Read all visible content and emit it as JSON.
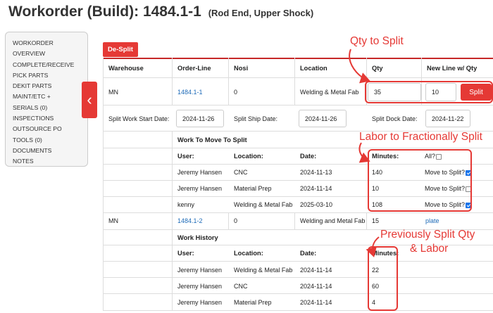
{
  "title": "Workorder (Build): 1484.1-1",
  "subtitle": "(Rod End, Upper Shock)",
  "sidebar": {
    "items": [
      "WORKORDER",
      "OVERVIEW",
      "COMPLETE/RECEIVE",
      "PICK PARTS",
      "DEKIT PARTS",
      "MAINT/ETC +",
      "SERIALS (0)",
      "INSPECTIONS",
      "OUTSOURCE PO",
      "TOOLS (0)",
      "DOCUMENTS",
      "NOTES"
    ]
  },
  "despl_label": "De-Split",
  "table": {
    "headers": [
      "Warehouse",
      "Order-Line",
      "Nosi",
      "Location",
      "Qty",
      "New Line w/ Qty"
    ],
    "row1": {
      "warehouse": "MN",
      "order_line": "1484.1-1",
      "nosi": "0",
      "location": "Welding & Metal Fab",
      "qty": "35",
      "new_qty": "10",
      "split_label": "Split"
    },
    "dates": {
      "work_start_label": "Split Work Start Date:",
      "work_start": "2024-11-26",
      "ship_label": "Split Ship Date:",
      "ship": "2024-11-26",
      "dock_label": "Split Dock Date:",
      "dock": "2024-11-22"
    },
    "work_to_move": {
      "title": "Work To Move To Split",
      "headers": [
        "User:",
        "Location:",
        "Date:",
        "Minutes:",
        "All?"
      ],
      "rows": [
        {
          "user": "Jeremy Hansen",
          "location": "CNC",
          "date": "2024-11-13",
          "minutes": "140",
          "move": "Move to Split?",
          "checked": true
        },
        {
          "user": "Jeremy Hansen",
          "location": "Material Prep",
          "date": "2024-11-14",
          "minutes": "10",
          "move": "Move to Split?",
          "checked": false
        },
        {
          "user": "kenny",
          "location": "Welding & Metal Fab",
          "date": "2025-03-10",
          "minutes": "108",
          "move": "Move to Split?",
          "checked": true
        }
      ]
    },
    "row2": {
      "warehouse": "MN",
      "order_line": "1484.1-2",
      "nosi": "0",
      "location": "Welding and Metal Fab",
      "qty": "15",
      "new": "plate"
    },
    "work_history": {
      "title": "Work History",
      "headers": [
        "User:",
        "Location:",
        "Date:",
        "Minutes:"
      ],
      "rows": [
        {
          "user": "Jeremy Hansen",
          "location": "Welding & Metal Fab",
          "date": "2024-11-14",
          "minutes": "22"
        },
        {
          "user": "Jeremy Hansen",
          "location": "CNC",
          "date": "2024-11-14",
          "minutes": "60"
        },
        {
          "user": "Jeremy Hansen",
          "location": "Material Prep",
          "date": "2024-11-14",
          "minutes": "4"
        }
      ]
    }
  },
  "annotations": {
    "qty_to_split": "Qty to Split",
    "labor": "Labor to Fractionally Split",
    "prev_line1": "Previously Split Qty",
    "prev_line2": "& Labor"
  },
  "colors": {
    "accent": "#e53935",
    "link": "#1e6bb8",
    "checkbox": "#1a73e8"
  }
}
